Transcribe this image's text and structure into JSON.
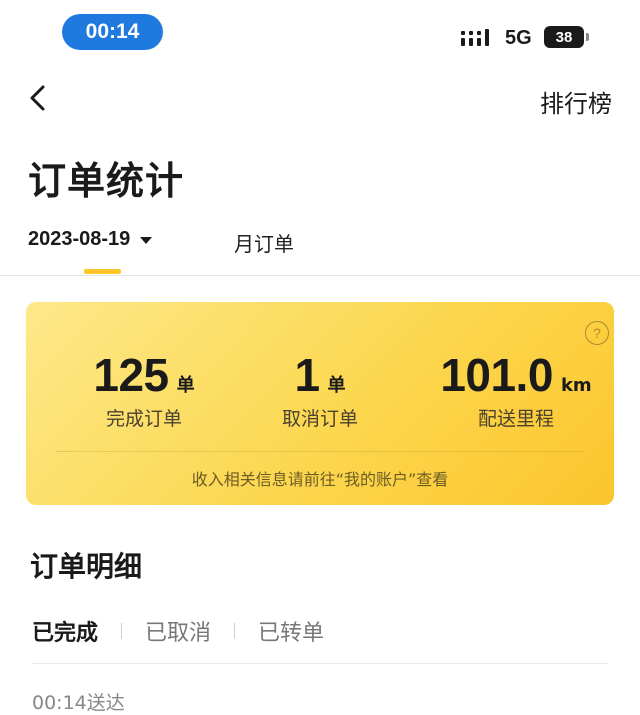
{
  "status_bar": {
    "time": "00:14",
    "network": "5G",
    "battery": "38"
  },
  "nav": {
    "back_icon": "chevron-left-icon",
    "ranking": "排行榜"
  },
  "page_title": "订单统计",
  "tabs": {
    "date": "2023-08-19",
    "month": "月订单"
  },
  "stats": [
    {
      "value": "125",
      "unit": "单",
      "label": "完成订单"
    },
    {
      "value": "1",
      "unit": "单",
      "label": "取消订单"
    },
    {
      "value": "101.0",
      "unit": "km",
      "label": "配送里程"
    }
  ],
  "card_note": "收入相关信息请前往“我的账户”查看",
  "help_icon": "?",
  "colors": {
    "accent": "#ffc62a",
    "status_pill": "#1f7ae0"
  },
  "detail": {
    "title": "订单明细",
    "filters": [
      "已完成",
      "已取消",
      "已转单"
    ],
    "first_order_time": "00:14送达"
  }
}
